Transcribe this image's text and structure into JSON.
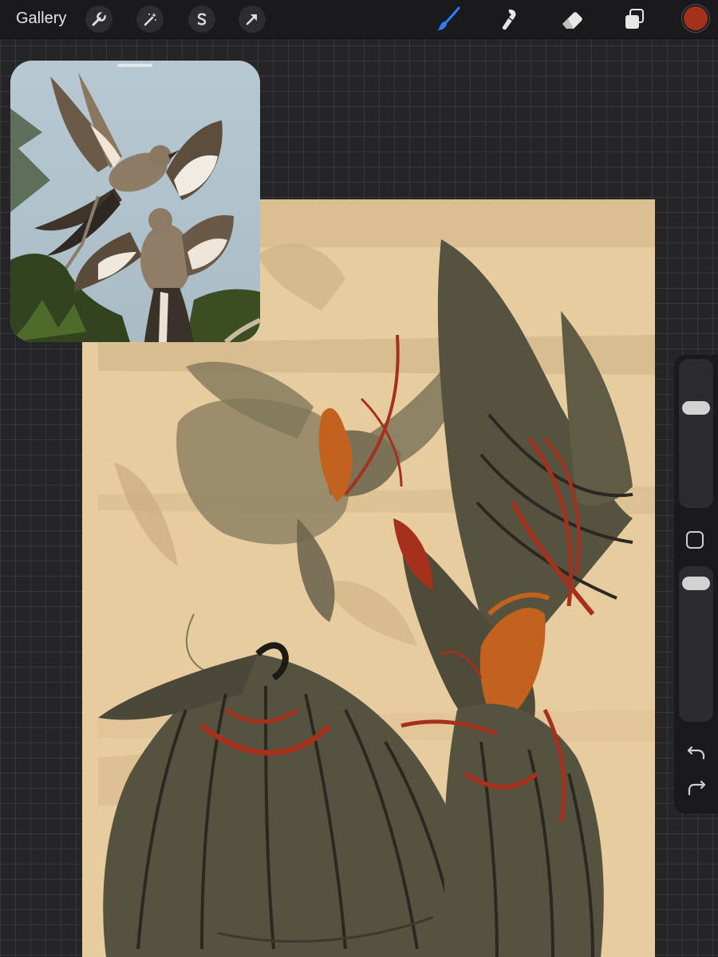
{
  "toolbar": {
    "gallery_label": "Gallery",
    "left_tools": [
      "wrench-icon",
      "magic-wand-icon",
      "selection-s-icon",
      "transform-arrow-icon"
    ],
    "right_tools": [
      "brush-icon",
      "smudge-icon",
      "eraser-icon",
      "layers-icon"
    ],
    "active_tool": "brush-icon",
    "current_color": "#a5311c",
    "active_tool_color": "#2f7cf6"
  },
  "reference_window": {
    "icon": "reference-image"
  },
  "canvas": {
    "background_color": "#e7cc9f",
    "primary_ink": "#55523f",
    "accent_red": "#a5311c",
    "accent_orange": "#c3611e"
  },
  "sidebar": {
    "brush_size_level": 0.7,
    "opacity_level": 0.95,
    "icons": [
      "modify-square-icon",
      "undo-icon",
      "redo-icon"
    ]
  }
}
